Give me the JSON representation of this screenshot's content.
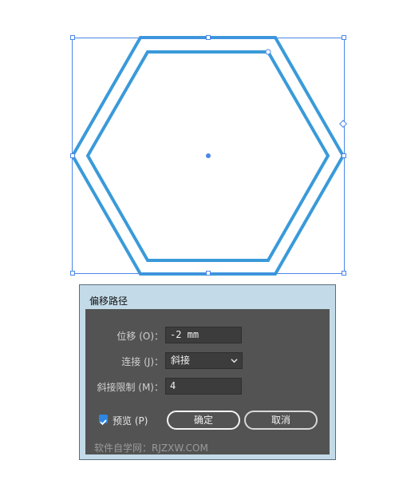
{
  "dialog": {
    "title": "偏移路径",
    "offset": {
      "label": "位移 (O)：",
      "value": "-2 mm"
    },
    "join": {
      "label": "连接 (J)：",
      "value": "斜接"
    },
    "miter_limit": {
      "label": "斜接限制 (M)：",
      "value": "4"
    },
    "preview": {
      "label": "预览 (P)",
      "checked": true
    },
    "ok_label": "确定",
    "cancel_label": "取消"
  },
  "watermark": "软件自学网：RJZXW.COM",
  "colors": {
    "shape_stroke": "#3a9ad9",
    "selection": "#4a87e8",
    "panel": "#535353",
    "checkbox": "#2d87e0"
  }
}
